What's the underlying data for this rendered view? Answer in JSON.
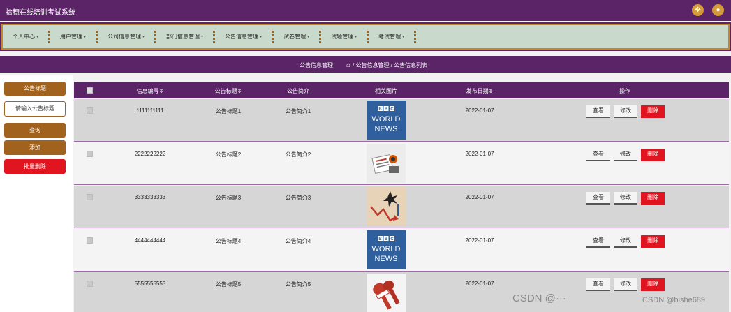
{
  "app": {
    "title": "拾穗在线培训考试系统"
  },
  "nav": {
    "items": [
      {
        "label": "个人中心"
      },
      {
        "label": "用户管理"
      },
      {
        "label": "公司信息管理"
      },
      {
        "label": "部门信息管理"
      },
      {
        "label": "公告信息管理"
      },
      {
        "label": "试卷管理"
      },
      {
        "label": "试题管理"
      },
      {
        "label": "考试管理"
      }
    ],
    "caret": "▾"
  },
  "breadcrumb": {
    "title": "公告信息管理",
    "path": "/ 公告信息管理 / 公告信息列表"
  },
  "sidebar": {
    "label": "公告标题",
    "input_placeholder": "请输入公告标题",
    "search_label": "查询",
    "add_label": "添加",
    "batch_delete_label": "批量删除"
  },
  "table": {
    "headers": {
      "id": "信息编号",
      "title": "公告标题",
      "intro": "公告简介",
      "image": "相关图片",
      "date": "发布日期",
      "actions": "操作"
    },
    "sort_mark": "⇕",
    "rows": [
      {
        "id": "1111111111",
        "title": "公告标题1",
        "intro": "公告简介1",
        "image": "bbc-news",
        "date": "2022-01-07"
      },
      {
        "id": "2222222222",
        "title": "公告标题2",
        "intro": "公告简介2",
        "image": "newspaper-illustration",
        "date": "2022-01-07"
      },
      {
        "id": "3333333333",
        "title": "公告标题3",
        "intro": "公告简介3",
        "image": "declining-chart-illustration",
        "date": "2022-01-07"
      },
      {
        "id": "4444444444",
        "title": "公告标题4",
        "intro": "公告简介4",
        "image": "bbc-news",
        "date": "2022-01-07"
      },
      {
        "id": "5555555555",
        "title": "公告标题5",
        "intro": "公告简介5",
        "image": "news-microphones",
        "date": "2022-01-07"
      }
    ],
    "actions": {
      "view": "查看",
      "edit": "修改",
      "delete": "删除"
    }
  },
  "bbc_image_text": {
    "line1": "WORLD",
    "line2": "NEWS",
    "blocks": [
      "B",
      "B",
      "C"
    ]
  },
  "watermark": {
    "left": "CSDN @···",
    "right": "CSDN @bishe689"
  },
  "colors": {
    "brand": "#5a2467",
    "accent": "#a0621d",
    "danger": "#e0151f",
    "nav_bg": "#c9d9cc"
  }
}
